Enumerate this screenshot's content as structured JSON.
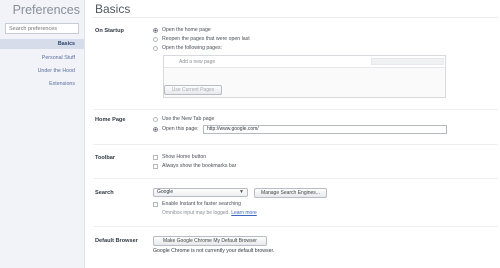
{
  "sidebar": {
    "title": "Preferences",
    "search_placeholder": "Search preferences",
    "items": [
      {
        "label": "Basics"
      },
      {
        "label": "Personal Stuff"
      },
      {
        "label": "Under the Hood"
      },
      {
        "label": "Extensions"
      }
    ]
  },
  "main": {
    "title": "Basics",
    "startup": {
      "label": "On Startup",
      "options": [
        "Open the home page",
        "Reopen the pages that were open last",
        "Open the following pages:"
      ],
      "add_page_label": "Add a new page",
      "use_current_label": "Use Current Pages"
    },
    "homepage": {
      "label": "Home Page",
      "option_newtab": "Use the New Tab page",
      "option_open": "Open this page:",
      "url": "http://www.google.com/"
    },
    "toolbar": {
      "label": "Toolbar",
      "options": [
        "Show Home button",
        "Always show the bookmarks bar"
      ]
    },
    "search": {
      "label": "Search",
      "engine": "Google",
      "manage_label": "Manage Search Engines...",
      "instant_label": "Enable Instant for faster searching",
      "omnibox_note": "Omnibox input may be logged",
      "learn_more": "Learn more"
    },
    "default_browser": {
      "label": "Default Browser",
      "button_label": "Make Google Chrome My Default Browser",
      "status": "Google Chrome is not currently your default browser."
    }
  }
}
